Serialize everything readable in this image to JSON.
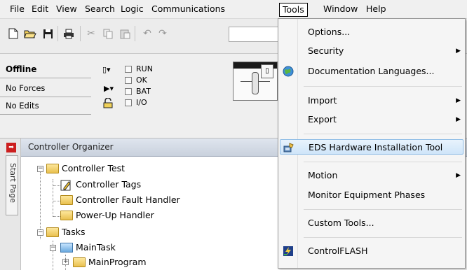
{
  "menubar": {
    "items": [
      "File",
      "Edit",
      "View",
      "Search",
      "Logic",
      "Communications",
      "Tools",
      "Window",
      "Help"
    ],
    "open_menu": "Tools"
  },
  "toolbar": {
    "icons": [
      "new-file-icon",
      "open-folder-icon",
      "save-icon",
      "print-icon",
      "cut-icon",
      "copy-icon",
      "paste-icon",
      "undo-icon",
      "redo-icon"
    ],
    "path_value": ""
  },
  "status": {
    "mode": "Offline",
    "forces": "No Forces",
    "edits": "No Edits",
    "leds": [
      "RUN",
      "OK",
      "BAT",
      "I/O"
    ]
  },
  "start_page": {
    "label": "Start Page"
  },
  "organizer": {
    "title": "Controller Organizer",
    "tree": [
      {
        "label": "Controller Test",
        "icon": "folder-icon",
        "expanded": true
      },
      {
        "label": "Controller Tags",
        "icon": "tags-icon"
      },
      {
        "label": "Controller Fault Handler",
        "icon": "folder-icon"
      },
      {
        "label": "Power-Up Handler",
        "icon": "folder-icon"
      },
      {
        "label": "Tasks",
        "icon": "folder-icon",
        "expanded": true
      },
      {
        "label": "MainTask",
        "icon": "task-icon",
        "expanded": true
      },
      {
        "label": "MainProgram",
        "icon": "program-icon",
        "expanded": false
      }
    ]
  },
  "tools_menu": {
    "items": [
      {
        "label": "Options...",
        "submenu": false
      },
      {
        "label": "Security",
        "submenu": true
      },
      {
        "label": "Documentation Languages...",
        "submenu": false,
        "icon": "globe-icon"
      },
      {
        "label": "Import",
        "submenu": true
      },
      {
        "label": "Export",
        "submenu": true
      },
      {
        "label": "EDS Hardware Installation Tool",
        "submenu": false,
        "icon": "eds-tool-icon",
        "highlighted": true
      },
      {
        "label": "Motion",
        "submenu": true
      },
      {
        "label": "Monitor Equipment Phases",
        "submenu": false
      },
      {
        "label": "Custom Tools...",
        "submenu": false
      },
      {
        "label": "ControlFLASH",
        "submenu": false,
        "icon": "controlflash-icon"
      }
    ]
  },
  "colors": {
    "menu_highlight_bg": "#cfe5f9",
    "menu_highlight_border": "#8fbde6",
    "organizer_header": "#c9d1dd",
    "folder": "#e9c04e"
  }
}
